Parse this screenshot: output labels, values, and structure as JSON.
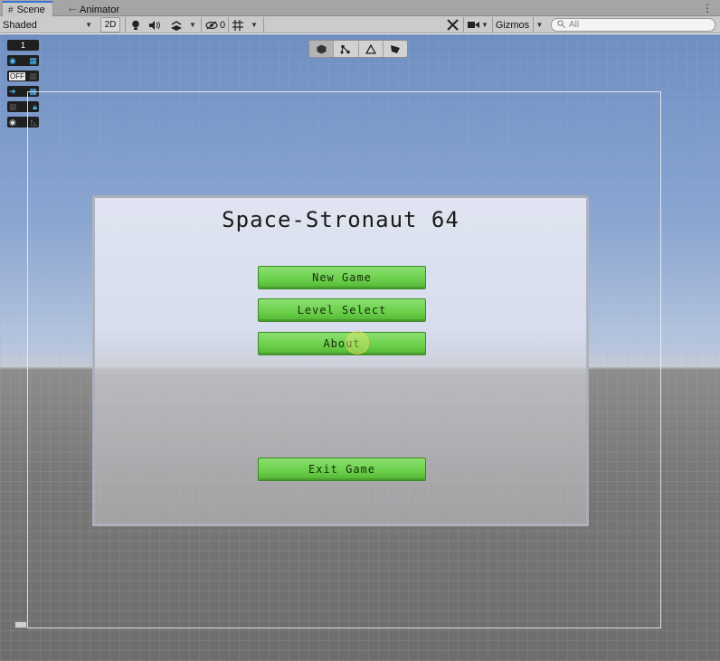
{
  "tabs": [
    {
      "label": "Scene",
      "icon": "grid-icon"
    },
    {
      "label": "Animator",
      "icon": "animator-icon"
    }
  ],
  "toolbar": {
    "shading_mode": "Shaded",
    "mode_2d": "2D",
    "hidden_count": "0",
    "gizmos_label": "Gizmos",
    "search_placeholder": "All"
  },
  "overlay": {
    "layer_number": "1",
    "off_label": "OFF"
  },
  "game": {
    "title": "Space-Stronaut 64",
    "buttons": {
      "new_game": "New Game",
      "level_select": "Level Select",
      "about": "About",
      "exit_game": "Exit Game"
    }
  },
  "colors": {
    "button_green": "#6acf4a",
    "tab_accent": "#3a72d8",
    "sky_blue": "#8aa6d1",
    "ground_gray": "#7a7877"
  }
}
